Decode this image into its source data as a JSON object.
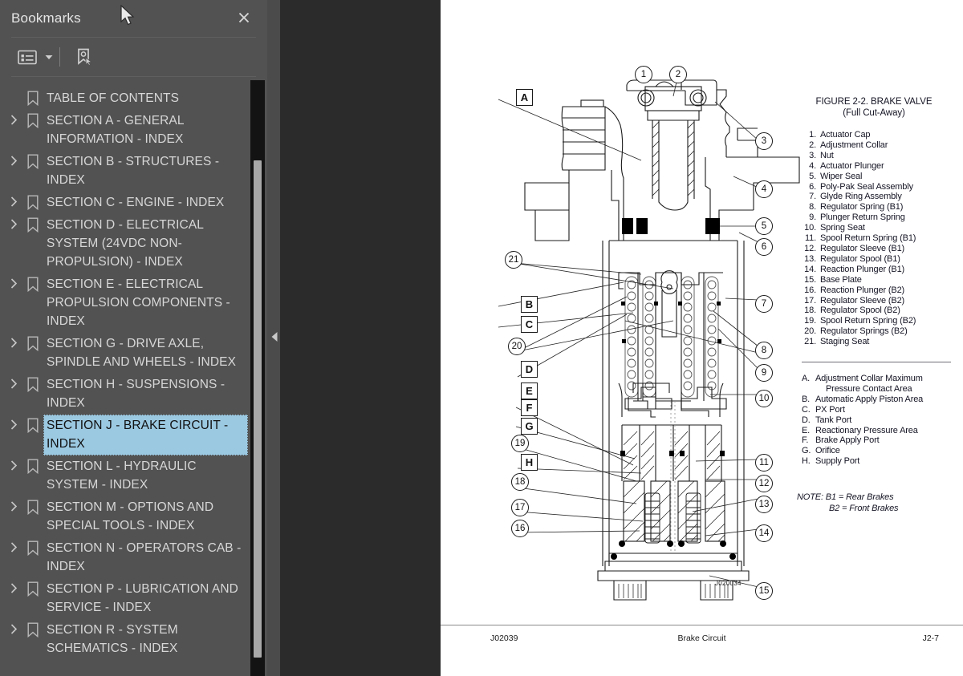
{
  "sidebar": {
    "title": "Bookmarks",
    "close_icon": "close-icon",
    "toolbar": {
      "options_label": "list-options-icon",
      "caret_label": "chevron-down-icon",
      "find_bookmark_label": "find-bookmark-icon"
    },
    "items": [
      {
        "label": "TABLE OF CONTENTS",
        "expandable": false,
        "selected": false
      },
      {
        "label": "SECTION A - GENERAL INFORMATION - INDEX",
        "expandable": true,
        "selected": false
      },
      {
        "label": "SECTION B - STRUCTURES - INDEX",
        "expandable": true,
        "selected": false
      },
      {
        "label": "SECTION C - ENGINE - INDEX",
        "expandable": true,
        "selected": false
      },
      {
        "label": "SECTION D - ELECTRICAL SYSTEM (24VDC NON-PROPULSION) - INDEX",
        "expandable": true,
        "selected": false
      },
      {
        "label": "SECTION E - ELECTRICAL PROPULSION COMPONENTS - INDEX",
        "expandable": true,
        "selected": false
      },
      {
        "label": "SECTION G - DRIVE AXLE, SPINDLE AND WHEELS - INDEX",
        "expandable": true,
        "selected": false
      },
      {
        "label": "SECTION H - SUSPENSIONS - INDEX",
        "expandable": true,
        "selected": false
      },
      {
        "label": "SECTION J - BRAKE CIRCUIT - INDEX",
        "expandable": true,
        "selected": true
      },
      {
        "label": "SECTION L - HYDRAULIC SYSTEM - INDEX",
        "expandable": true,
        "selected": false
      },
      {
        "label": "SECTION M - OPTIONS AND SPECIAL TOOLS - INDEX",
        "expandable": true,
        "selected": false
      },
      {
        "label": "SECTION N - OPERATORS CAB - INDEX",
        "expandable": true,
        "selected": false
      },
      {
        "label": "SECTION P - LUBRICATION AND SERVICE - INDEX",
        "expandable": true,
        "selected": false
      },
      {
        "label": "SECTION R - SYSTEM SCHEMATICS - INDEX",
        "expandable": true,
        "selected": false
      }
    ],
    "selection_color": "#9cc9e2",
    "background_color": "#525252"
  },
  "document": {
    "figure": {
      "title": "FIGURE 2-2. BRAKE VALVE",
      "subtitle": "(Full Cut-Away)",
      "numbered_parts": [
        {
          "n": "1.",
          "t": "Actuator Cap"
        },
        {
          "n": "2.",
          "t": "Adjustment Collar"
        },
        {
          "n": "3.",
          "t": "Nut"
        },
        {
          "n": "4.",
          "t": "Actuator Plunger"
        },
        {
          "n": "5.",
          "t": "Wiper Seal"
        },
        {
          "n": "6.",
          "t": "Poly-Pak Seal Assembly"
        },
        {
          "n": "7.",
          "t": "Glyde Ring Assembly"
        },
        {
          "n": "8.",
          "t": "Regulator Spring (B1)"
        },
        {
          "n": "9.",
          "t": "Plunger Return Spring"
        },
        {
          "n": "10.",
          "t": "Spring Seat"
        },
        {
          "n": "11.",
          "t": "Spool Return Spring (B1)"
        },
        {
          "n": "12.",
          "t": "Regulator Sleeve (B1)"
        },
        {
          "n": "13.",
          "t": "Regulator Spool (B1)"
        },
        {
          "n": "14.",
          "t": "Reaction Plunger (B1)"
        },
        {
          "n": "15.",
          "t": "Base Plate"
        },
        {
          "n": "16.",
          "t": "Reaction Plunger (B2)"
        },
        {
          "n": "17.",
          "t": "Regulator Sleeve (B2)"
        },
        {
          "n": "18.",
          "t": "Regulator Spool (B2)"
        },
        {
          "n": "19.",
          "t": "Spool Return Spring (B2)"
        },
        {
          "n": "20.",
          "t": "Regulator Springs (B2)"
        },
        {
          "n": "21.",
          "t": "Staging Seat"
        }
      ],
      "lettered_areas": [
        {
          "n": "A.",
          "t": "Adjustment Collar Maximum",
          "cont": "Pressure Contact Area"
        },
        {
          "n": "B.",
          "t": "Automatic Apply Piston Area",
          "cont": ""
        },
        {
          "n": "C.",
          "t": "PX Port",
          "cont": ""
        },
        {
          "n": "D.",
          "t": "Tank Port",
          "cont": ""
        },
        {
          "n": "E.",
          "t": "Reactionary Pressure Area",
          "cont": ""
        },
        {
          "n": "F.",
          "t": "Brake Apply Port",
          "cont": ""
        },
        {
          "n": "G.",
          "t": "Orifice",
          "cont": ""
        },
        {
          "n": "H.",
          "t": "Supply Port",
          "cont": ""
        }
      ],
      "note_line1": "NOTE: B1 = Rear Brakes",
      "note_line2": "B2 = Front Brakes",
      "drawing_id": "J020034",
      "number_callouts": [
        "1",
        "2",
        "3",
        "4",
        "5",
        "6",
        "7",
        "8",
        "9",
        "10",
        "11",
        "12",
        "13",
        "14",
        "15",
        "16",
        "17",
        "18",
        "19",
        "20",
        "21"
      ],
      "letter_callouts": [
        "A",
        "B",
        "C",
        "D",
        "E",
        "F",
        "G",
        "H"
      ]
    },
    "footer": {
      "left": "J02039",
      "center": "Brake Circuit",
      "right": "J2-7"
    }
  },
  "viewer": {
    "collapse_icon": "chevron-left-icon",
    "background_color": "#2b2b2b"
  }
}
